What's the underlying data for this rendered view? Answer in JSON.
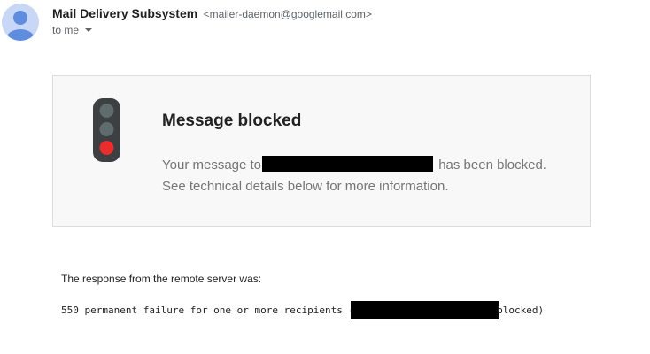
{
  "header": {
    "avatar_icon": "person-avatar-icon",
    "sender_name": "Mail Delivery Subsystem",
    "sender_email": "<mailer-daemon@googlemail.com>",
    "recipient_label": "to me",
    "recipient_dropdown_icon": "chevron-down-icon"
  },
  "card": {
    "icon": "traffic-light-icon",
    "title": "Message blocked",
    "body_prefix": "Your message to",
    "body_suffix": "has been blocked.",
    "body_line2": "See technical details below for more information."
  },
  "response": {
    "label": "The response from the remote server was:",
    "code_prefix": "550 permanent failure for one or more recipients (",
    "code_suffix": "blocked)"
  },
  "colors": {
    "avatar_bg": "#c7d7f5",
    "avatar_fg": "#5e8de0",
    "light_housing": "#3c4043",
    "light_off": "#5f6b6d",
    "light_red": "#ea2c2c",
    "card_bg": "#f8f8f8"
  }
}
